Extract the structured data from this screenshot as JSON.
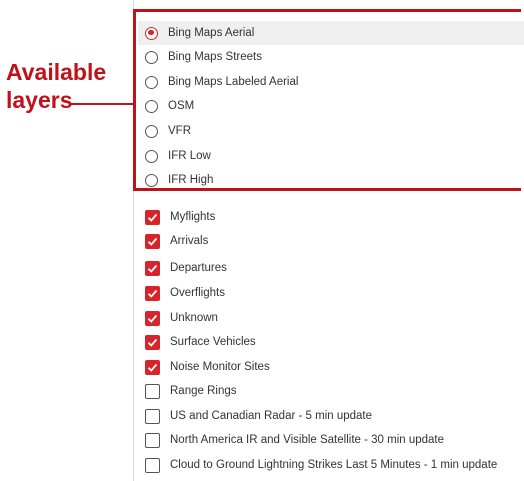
{
  "annotation": {
    "line1": "Available",
    "line2": "layers"
  },
  "colors": {
    "accent": "#d8232a",
    "annotation": "#c0121b"
  },
  "base_layers": [
    {
      "label": "Bing Maps Aerial",
      "selected": true
    },
    {
      "label": "Bing Maps Streets",
      "selected": false
    },
    {
      "label": "Bing Maps Labeled Aerial",
      "selected": false
    },
    {
      "label": "OSM",
      "selected": false
    },
    {
      "label": "VFR",
      "selected": false
    },
    {
      "label": "IFR Low",
      "selected": false
    },
    {
      "label": "IFR High",
      "selected": false
    }
  ],
  "overlays": [
    {
      "label": "Myflights",
      "checked": true
    },
    {
      "label": "Arrivals",
      "checked": true
    },
    {
      "label": "Departures",
      "checked": true
    },
    {
      "label": "Overflights",
      "checked": true
    },
    {
      "label": "Unknown",
      "checked": true
    },
    {
      "label": "Surface Vehicles",
      "checked": true
    },
    {
      "label": "Noise Monitor Sites",
      "checked": true
    },
    {
      "label": "Range Rings",
      "checked": false
    },
    {
      "label": "US and Canadian Radar - 5 min update",
      "checked": false
    },
    {
      "label": "North America IR and Visible Satellite - 30 min update",
      "checked": false
    },
    {
      "label": "Cloud to Ground Lightning Strikes Last 5 Minutes - 1 min update",
      "checked": false
    }
  ]
}
